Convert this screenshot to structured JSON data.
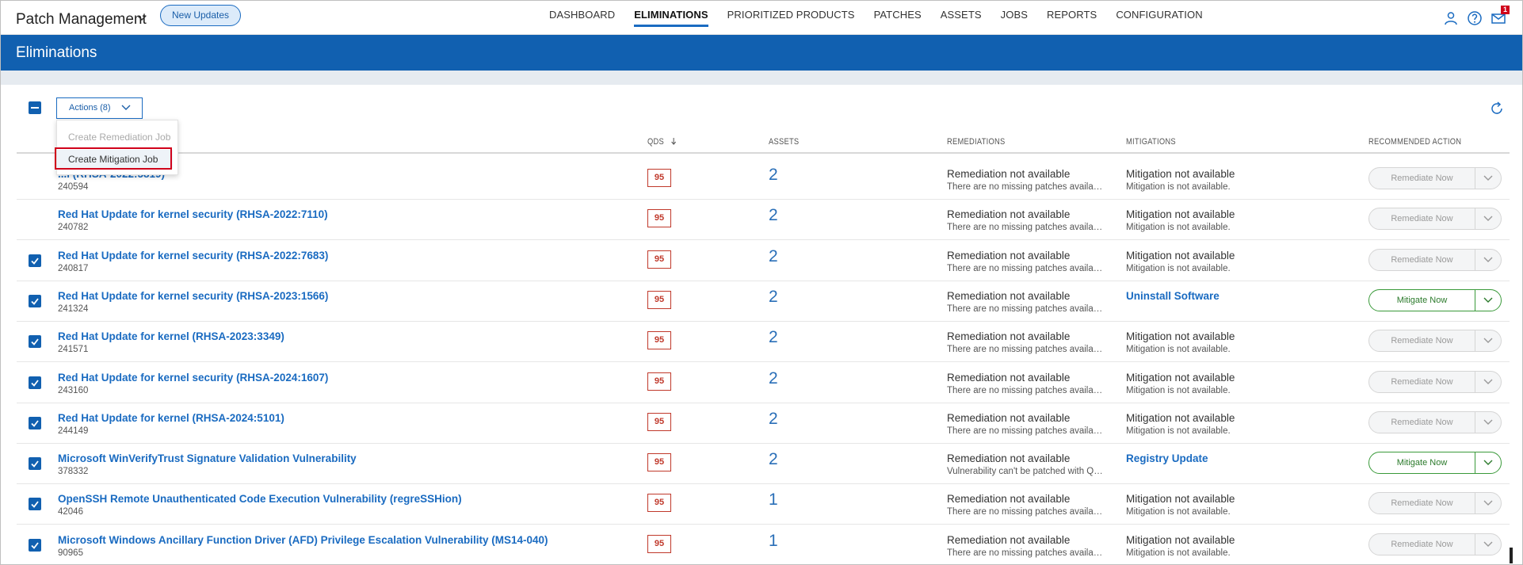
{
  "app": {
    "title": "Patch Management",
    "new_updates_label": "New Updates",
    "nav": [
      "DASHBOARD",
      "ELIMINATIONS",
      "PRIORITIZED PRODUCTS",
      "PATCHES",
      "ASSETS",
      "JOBS",
      "REPORTS",
      "CONFIGURATION"
    ],
    "active_nav": "ELIMINATIONS",
    "notification_count": "1",
    "icons": [
      "user-icon",
      "help-icon",
      "mail-icon"
    ]
  },
  "page": {
    "title": "Eliminations"
  },
  "toolbar": {
    "actions_label": "Actions (8)"
  },
  "actions_menu": {
    "items": [
      "Create Remediation Job",
      "Create Mitigation Job"
    ]
  },
  "table": {
    "headers": {
      "qds": "QDS",
      "assets": "ASSETS",
      "remediations": "REMEDIATIONS",
      "mitigations": "MITIGATIONS",
      "recommended": "RECOMMENDED ACTION"
    },
    "rows": [
      {
        "title": "...l (RHSA-2022:5819)",
        "id": "240594",
        "checked": false,
        "qds": "95",
        "assets": "2",
        "rem_title": "Remediation not available",
        "rem_sub": "There are no missing patches available",
        "mit_title": "Mitigation not available",
        "mit_sub": "Mitigation is not available.",
        "mit_link": false,
        "action": "Remediate Now",
        "action_active": false
      },
      {
        "title": "Red Hat Update for kernel security (RHSA-2022:7110)",
        "id": "240782",
        "checked": false,
        "qds": "95",
        "assets": "2",
        "rem_title": "Remediation not available",
        "rem_sub": "There are no missing patches available",
        "mit_title": "Mitigation not available",
        "mit_sub": "Mitigation is not available.",
        "mit_link": false,
        "action": "Remediate Now",
        "action_active": false
      },
      {
        "title": "Red Hat Update for kernel security (RHSA-2022:7683)",
        "id": "240817",
        "checked": true,
        "qds": "95",
        "assets": "2",
        "rem_title": "Remediation not available",
        "rem_sub": "There are no missing patches available",
        "mit_title": "Mitigation not available",
        "mit_sub": "Mitigation is not available.",
        "mit_link": false,
        "action": "Remediate Now",
        "action_active": false
      },
      {
        "title": "Red Hat Update for kernel security (RHSA-2023:1566)",
        "id": "241324",
        "checked": true,
        "qds": "95",
        "assets": "2",
        "rem_title": "Remediation not available",
        "rem_sub": "There are no missing patches available",
        "mit_title": "Uninstall Software",
        "mit_sub": "",
        "mit_link": true,
        "action": "Mitigate Now",
        "action_active": true
      },
      {
        "title": "Red Hat Update for kernel (RHSA-2023:3349)",
        "id": "241571",
        "checked": true,
        "qds": "95",
        "assets": "2",
        "rem_title": "Remediation not available",
        "rem_sub": "There are no missing patches available",
        "mit_title": "Mitigation not available",
        "mit_sub": "Mitigation is not available.",
        "mit_link": false,
        "action": "Remediate Now",
        "action_active": false
      },
      {
        "title": "Red Hat Update for kernel security (RHSA-2024:1607)",
        "id": "243160",
        "checked": true,
        "qds": "95",
        "assets": "2",
        "rem_title": "Remediation not available",
        "rem_sub": "There are no missing patches available",
        "mit_title": "Mitigation not available",
        "mit_sub": "Mitigation is not available.",
        "mit_link": false,
        "action": "Remediate Now",
        "action_active": false
      },
      {
        "title": "Red Hat Update for kernel (RHSA-2024:5101)",
        "id": "244149",
        "checked": true,
        "qds": "95",
        "assets": "2",
        "rem_title": "Remediation not available",
        "rem_sub": "There are no missing patches available",
        "mit_title": "Mitigation not available",
        "mit_sub": "Mitigation is not available.",
        "mit_link": false,
        "action": "Remediate Now",
        "action_active": false
      },
      {
        "title": "Microsoft WinVerifyTrust Signature Validation Vulnerability",
        "id": "378332",
        "checked": true,
        "qds": "95",
        "assets": "2",
        "rem_title": "Remediation not available",
        "rem_sub": "Vulnerability can't be patched with Qua...",
        "mit_title": "Registry Update",
        "mit_sub": "",
        "mit_link": true,
        "action": "Mitigate Now",
        "action_active": true
      },
      {
        "title": "OpenSSH Remote Unauthenticated Code Execution Vulnerability (regreSSHion)",
        "id": "42046",
        "checked": true,
        "qds": "95",
        "assets": "1",
        "rem_title": "Remediation not available",
        "rem_sub": "There are no missing patches available",
        "mit_title": "Mitigation not available",
        "mit_sub": "Mitigation is not available.",
        "mit_link": false,
        "action": "Remediate Now",
        "action_active": false
      },
      {
        "title": "Microsoft Windows Ancillary Function Driver (AFD) Privilege Escalation Vulnerability (MS14-040)",
        "id": "90965",
        "checked": true,
        "qds": "95",
        "assets": "1",
        "rem_title": "Remediation not available",
        "rem_sub": "There are no missing patches available",
        "mit_title": "Mitigation not available",
        "mit_sub": "Mitigation is not available.",
        "mit_link": false,
        "action": "Remediate Now",
        "action_active": false
      }
    ]
  },
  "colors": {
    "brand_blue": "#1160b0",
    "link_blue": "#1a6bc1",
    "qds_red": "#c0392b",
    "mitigate_green": "#3a9a3a"
  }
}
